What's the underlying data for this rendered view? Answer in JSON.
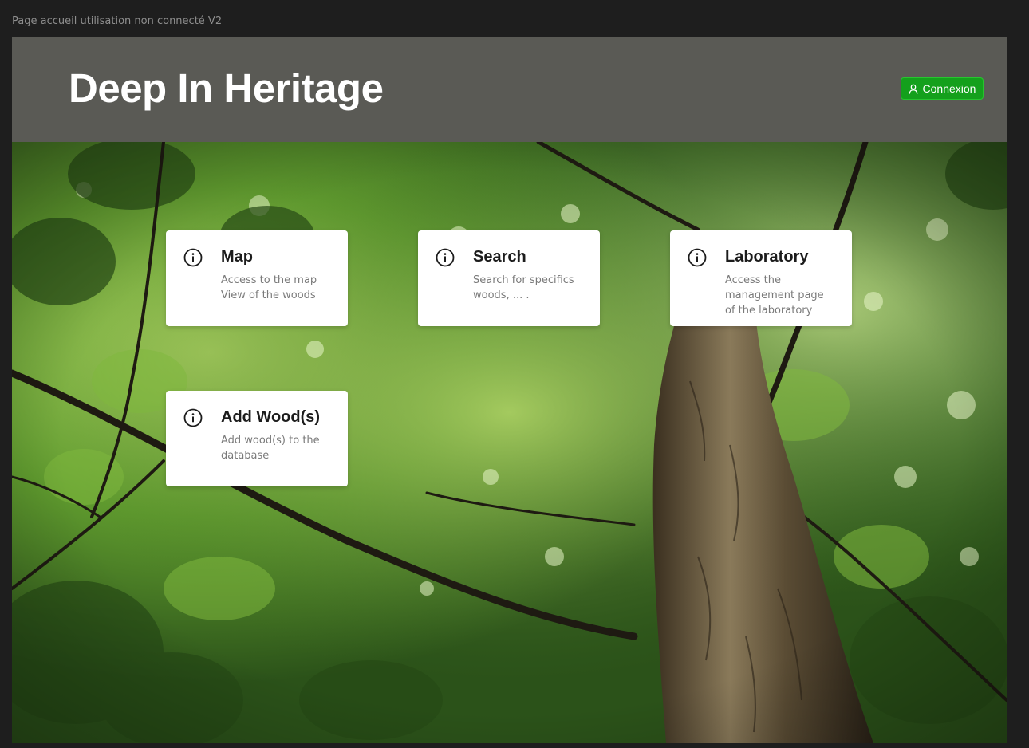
{
  "canvas": {
    "label": "Page accueil utilisation non connecté V2"
  },
  "header": {
    "title": "Deep In Heritage",
    "login_button": {
      "icon": "user-icon",
      "label": "Connexion",
      "color": "#14a01c"
    },
    "background_color": "#5a5a55"
  },
  "hero": {
    "image": "forest canopy photo with tree trunk"
  },
  "cards": [
    {
      "icon": "info-icon",
      "title": "Map",
      "description": "Access to the map\nView of the woods"
    },
    {
      "icon": "info-icon",
      "title": "Search",
      "description": "Search for specifics\nwoods, ... ."
    },
    {
      "icon": "info-icon",
      "title": "Laboratory",
      "description": "Access the\nmanagement page\nof the laboratory"
    },
    {
      "icon": "info-icon",
      "title": "Add Wood(s)",
      "description": "Add wood(s) to the\ndatabase"
    }
  ]
}
